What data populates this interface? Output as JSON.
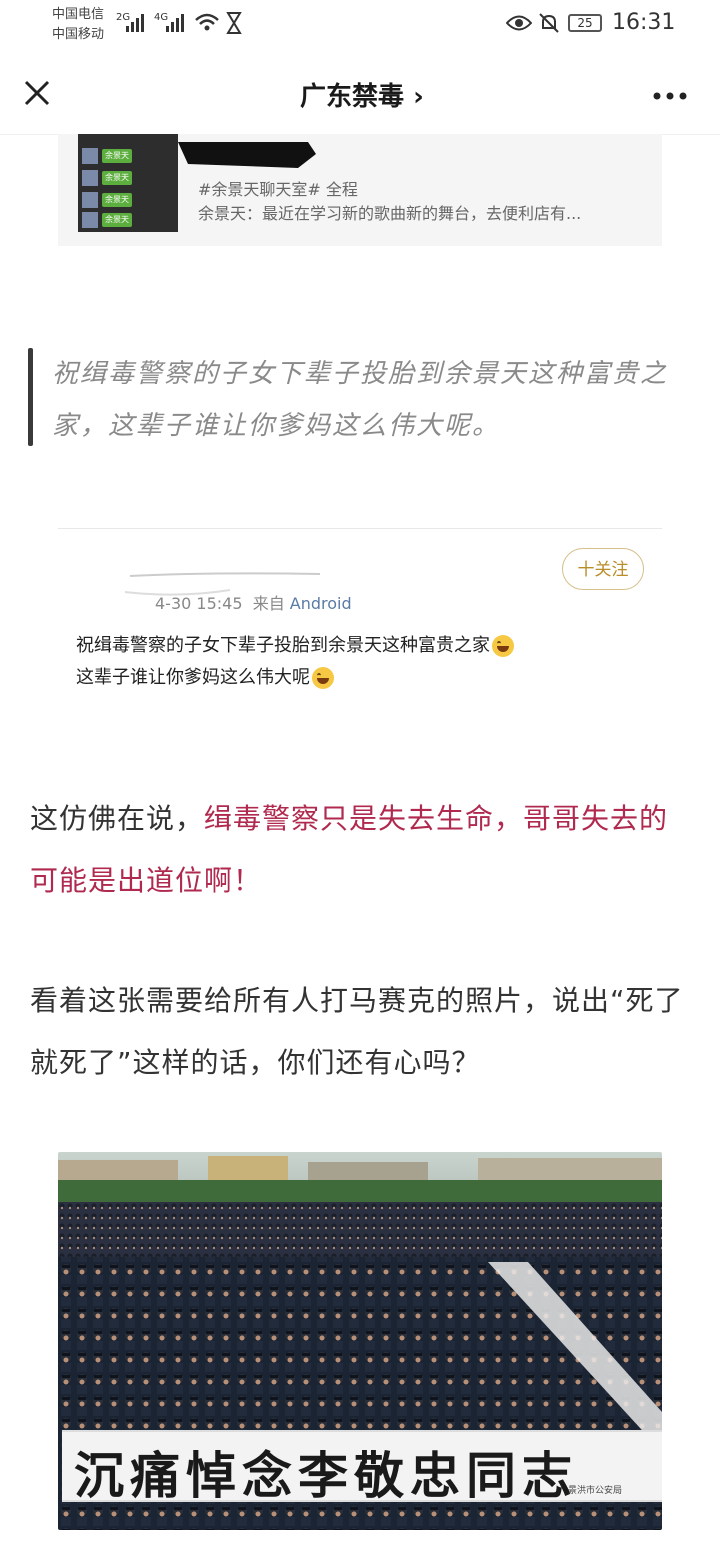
{
  "status_bar": {
    "carrier1": "中国电信",
    "carrier2": "中国移动",
    "net1": "2G",
    "net2": "4G",
    "battery": "25",
    "time": "16:31"
  },
  "nav": {
    "title": "广东禁毒",
    "chevron": "›",
    "close_icon": "close-icon",
    "more_icon": "more-icon"
  },
  "fragment": {
    "chat_labels": [
      "余景天",
      "余景天",
      "余景天",
      "余景天"
    ],
    "line1": "#余景天聊天室# 全程",
    "line2": "余景天：最近在学习新的歌曲新的舞台，去便利店有..."
  },
  "quote": {
    "text": "祝缉毒警察的子女下辈子投胎到余景天这种富贵之家，这辈子谁让你爹妈这么伟大呢。"
  },
  "weibo": {
    "follow_label": "十关注",
    "timestamp": "4-30 15:45",
    "source_prefix": "来自",
    "source": "Android",
    "post_line1": "祝缉毒警察的子女下辈子投胎到余景天这种富贵之家",
    "post_line2": "这辈子谁让你爹妈这么伟大呢"
  },
  "article": {
    "p1_normal": "这仿佛在说，",
    "p1_highlight": "缉毒警察只是失去生命，哥哥失去的可能是出道位啊！",
    "p2": "看着这张需要给所有人打马赛克的照片，说出“死了就死了”这样的话，你们还有心吗？"
  },
  "photo": {
    "banner_text": "沉痛悼念李敬忠同志",
    "banner_small": "景洪市公安局"
  },
  "colors": {
    "highlight": "#b0294f",
    "follow": "#b98d28",
    "source_link": "#5a7ba6"
  }
}
